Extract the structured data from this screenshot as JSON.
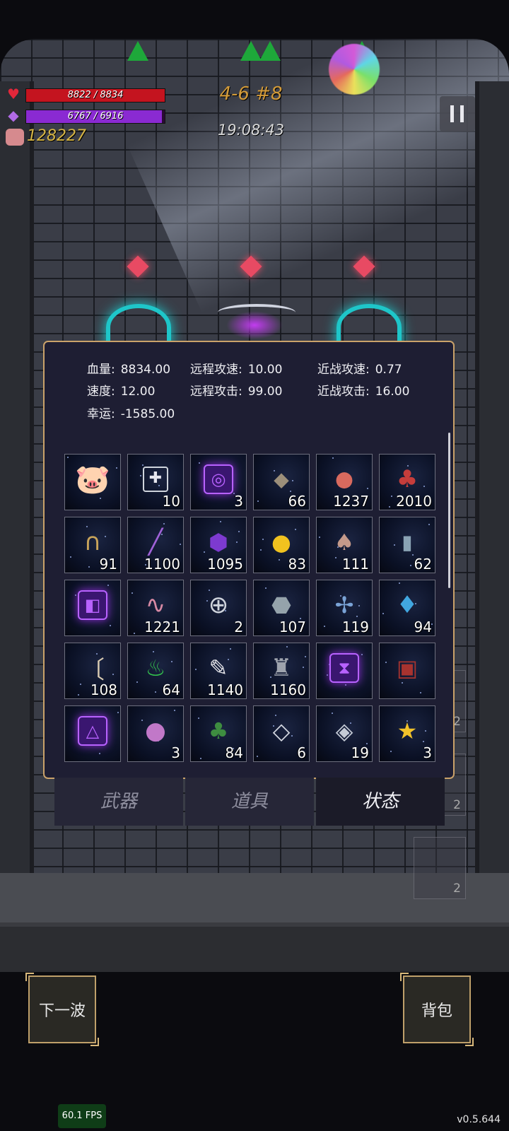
{
  "hud": {
    "hp_text": "8822 / 8834",
    "hp_fraction": 0.9986,
    "mp_text": "6767 / 6916",
    "mp_fraction": 0.9785,
    "gold": "128227",
    "wave": "4-6 #8",
    "timer": "19:08:43",
    "colors": {
      "hp": "#c4141f",
      "mp": "#8a2ad2",
      "gold": "#d6b545",
      "wave": "#d39b3a"
    }
  },
  "status": {
    "stats": [
      {
        "label": "血量:",
        "value": "8834.00"
      },
      {
        "label": "远程攻速:",
        "value": "10.00"
      },
      {
        "label": "近战攻速:",
        "value": "0.77"
      },
      {
        "label": "速度:",
        "value": "12.00"
      },
      {
        "label": "远程攻击:",
        "value": "99.00"
      },
      {
        "label": "近战攻击:",
        "value": "16.00"
      },
      {
        "label": "幸运:",
        "value": "-1585.00"
      }
    ],
    "items": [
      {
        "icon": "piggy-bank-icon",
        "count": ""
      },
      {
        "icon": "medkit-icon",
        "count": "10"
      },
      {
        "icon": "purple-spiral-rune-icon",
        "count": "3"
      },
      {
        "icon": "rocks-icon",
        "count": "66"
      },
      {
        "icon": "peach-icon",
        "count": "1237"
      },
      {
        "icon": "coin-sack-icon",
        "count": "2010"
      },
      {
        "icon": "horseshoe-icon",
        "count": "91"
      },
      {
        "icon": "purple-wand-icon",
        "count": "1100"
      },
      {
        "icon": "purple-crystal-cart-icon",
        "count": "1095"
      },
      {
        "icon": "gold-orb-icon",
        "count": "83"
      },
      {
        "icon": "clay-vase-icon",
        "count": "111"
      },
      {
        "icon": "bottle-icon",
        "count": "62"
      },
      {
        "icon": "purple-hook-rune-icon",
        "count": ""
      },
      {
        "icon": "worm-icon",
        "count": "1221"
      },
      {
        "icon": "cross-ring-icon",
        "count": "2"
      },
      {
        "icon": "stone-icon",
        "count": "107"
      },
      {
        "icon": "dragonfly-icon",
        "count": "119"
      },
      {
        "icon": "blue-crystal-icon",
        "count": "94"
      },
      {
        "icon": "horn-icon",
        "count": "108"
      },
      {
        "icon": "green-potion-icon",
        "count": "64"
      },
      {
        "icon": "feather-icon",
        "count": "1140"
      },
      {
        "icon": "hooded-statue-icon",
        "count": "1160"
      },
      {
        "icon": "purple-hourglass-rune-icon",
        "count": ""
      },
      {
        "icon": "red-spellbook-icon",
        "count": ""
      },
      {
        "icon": "purple-triangle-rune-icon",
        "count": ""
      },
      {
        "icon": "pink-slime-icon",
        "count": "3"
      },
      {
        "icon": "clover-icon",
        "count": "84"
      },
      {
        "icon": "chevron-tile-icon",
        "count": "6"
      },
      {
        "icon": "diamond-frame-icon",
        "count": "19"
      },
      {
        "icon": "star-trophy-icon",
        "count": "3"
      }
    ],
    "tabs": [
      {
        "label": "武器",
        "active": false
      },
      {
        "label": "道具",
        "active": false
      },
      {
        "label": "状态",
        "active": true
      }
    ]
  },
  "side_slots": [
    "2",
    "2",
    "2"
  ],
  "buttons": {
    "next_wave": "下一波",
    "backpack": "背包"
  },
  "fps": "60.1 FPS",
  "version": "v0.5.644"
}
